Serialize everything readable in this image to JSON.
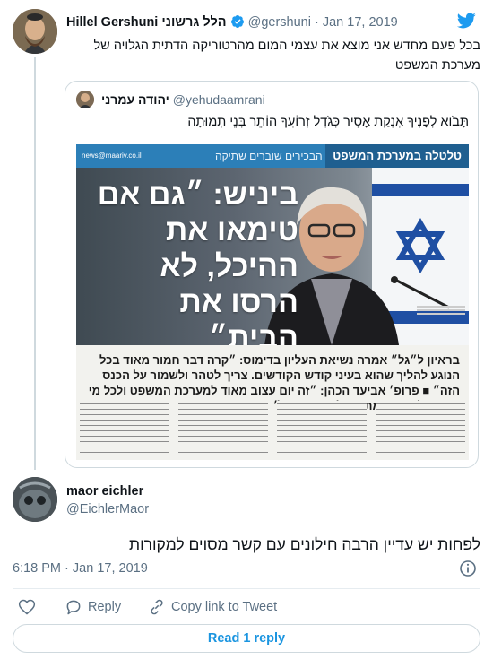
{
  "tweet": {
    "author_name": "Hillel Gershuni הלל גרשוני",
    "handle": "@gershuni",
    "separator": "·",
    "date": "Jan 17, 2019",
    "text": "בכל פעם מחדש אני מוצא את עצמי המום מהרטוריקה הדתית הגלויה של מערכת המשפט"
  },
  "quote": {
    "author_name": "יהודה עמרני",
    "handle": "@yehudaamrani",
    "text": "תָּבֹוא לְפָנֶיךָ אֶנְקַת אָסִיר כְּגֹדֶל זְרוֹעֲךָ הוֹתֵר בְּנֵי תְמוּתָה",
    "newspaper": {
      "site": "news@maariv.co.il",
      "section_tag": "טלטלה במערכת המשפט",
      "section_sub": "הבכירים שוברים שתיקה",
      "headline": "ביניש: ״גם אם טימאו את ההיכל, לא הרסו את הבית״",
      "lead": "בראיון ל״גל״ אמרה נשיאת העליון בדימוס: ״קרה דבר חמור מאוד בכל הנוגע להליך שהוא בעיני קודש הקודשים. צריך לטהר ולשמור על הכנס הזה״ ■ פרופ׳ אביעד הכהן: ״זה יום עצוב מאוד למערכת המשפט ולכל מי שמושג ׳מדינה מתוקנת׳ יקר בעיניו״"
    }
  },
  "reply": {
    "author_name": "maor eichler",
    "handle": "@EichlerMaor",
    "text": "לפחות יש עדיין הרבה חילונים עם קשר מסוים למקורות",
    "time": "6:18 PM",
    "date": "Jan 17, 2019"
  },
  "actions": {
    "reply_label": "Reply",
    "copy_label": "Copy link to Tweet",
    "read_replies_label": "Read 1 reply"
  },
  "colors": {
    "accent": "#1b95e0",
    "twitter_blue": "#1d9bf0",
    "muted_text": "#5b7083",
    "border": "#cfd9de"
  }
}
